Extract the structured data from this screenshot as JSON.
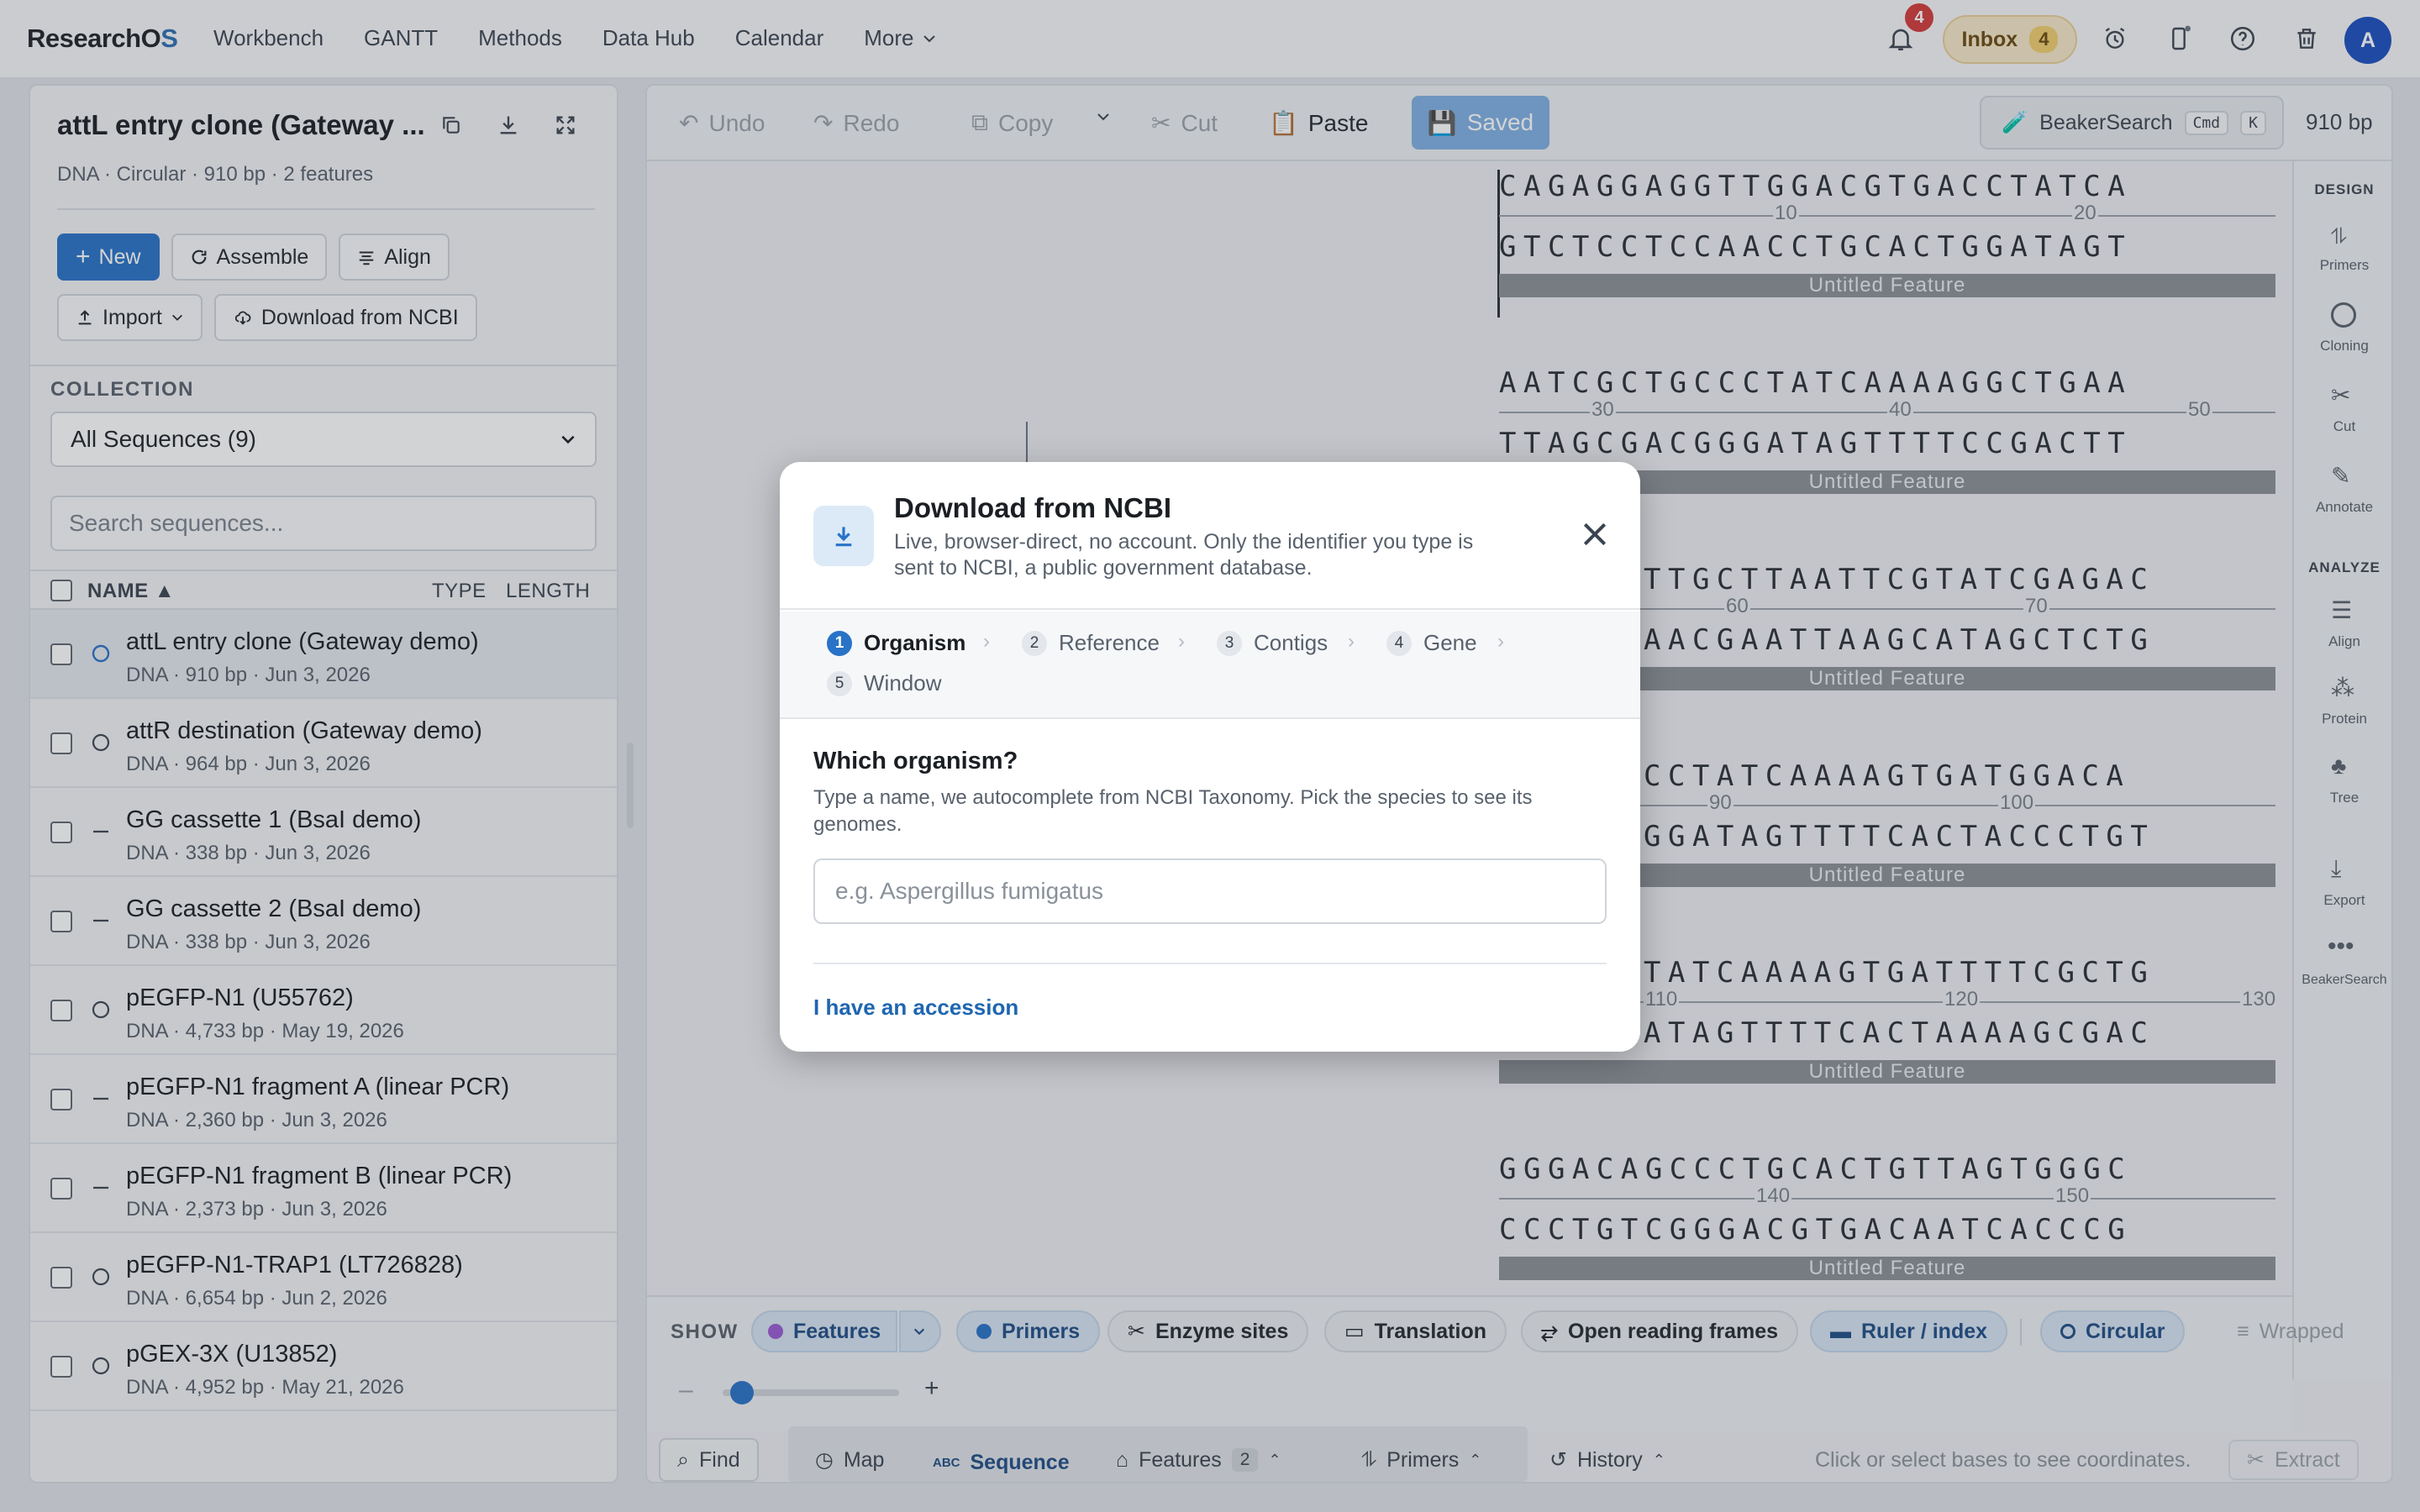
{
  "app": {
    "logo_main": "ResearchO",
    "logo_accent": "S",
    "avatar_initial": "A",
    "notifications_count": "4",
    "inbox_label": "Inbox",
    "inbox_count": "4"
  },
  "nav": [
    "Workbench",
    "GANTT",
    "Methods",
    "Data Hub",
    "Calendar",
    "More"
  ],
  "left": {
    "title": "attL entry clone (Gateway ...",
    "subtitle": "DNA · Circular · 910 bp · 2 features",
    "buttons": {
      "new": "New",
      "assemble": "Assemble",
      "align": "Align",
      "import": "Import",
      "ncbi": "Download from NCBI"
    },
    "collection_label": "COLLECTION",
    "collection_value": "All Sequences (9)",
    "search_placeholder": "Search sequences...",
    "columns": {
      "name": "NAME ▲",
      "type": "TYPE",
      "length": "LENGTH"
    },
    "rows": [
      {
        "name": "attL entry clone (Gateway demo)",
        "meta": "DNA · 910 bp · Jun 3, 2026"
      },
      {
        "name": "attR destination (Gateway demo)",
        "meta": "DNA · 964 bp · Jun 3, 2026"
      },
      {
        "name": "GG cassette 1 (BsaI demo)",
        "meta": "DNA · 338 bp · Jun 3, 2026"
      },
      {
        "name": "GG cassette 2 (BsaI demo)",
        "meta": "DNA · 338 bp · Jun 3, 2026"
      },
      {
        "name": "pEGFP-N1 (U55762)",
        "meta": "DNA · 4,733 bp · May 19, 2026"
      },
      {
        "name": "pEGFP-N1 fragment A (linear PCR)",
        "meta": "DNA · 2,360 bp · Jun 3, 2026"
      },
      {
        "name": "pEGFP-N1 fragment B (linear PCR)",
        "meta": "DNA · 2,373 bp · Jun 3, 2026"
      },
      {
        "name": "pEGFP-N1-TRAP1 (LT726828)",
        "meta": "DNA · 6,654 bp · Jun 2, 2026"
      },
      {
        "name": "pGEX-3X (U13852)",
        "meta": "DNA · 4,952 bp · May 21, 2026"
      }
    ]
  },
  "toolbar": {
    "undo": "Undo",
    "redo": "Redo",
    "copy": "Copy",
    "cut": "Cut",
    "paste": "Paste",
    "saved": "Saved",
    "beaker": "BeakerSearch",
    "kbd_cmd": "Cmd",
    "kbd_k": "K",
    "bp": "910 bp"
  },
  "rail": {
    "design": "DESIGN",
    "primers": "Primers",
    "cloning": "Cloning",
    "cut": "Cut",
    "annotate": "Annotate",
    "analyze": "ANALYZE",
    "align": "Align",
    "protein": "Protein",
    "tree": "Tree",
    "export": "Export",
    "beaker": "BeakerSearch"
  },
  "sequence": {
    "feature_label": "Untitled Feature",
    "blocks": [
      {
        "top": "CAGAGGAGGTTGGACGTGACCTATCA",
        "bottom": "GTCTCCTCCAACCTGCACTGGATAGT",
        "ticks": [
          "10",
          "20"
        ]
      },
      {
        "top": "AATCGCTGCCCTATCAAAAGGCTGAA",
        "bottom": "TTAGCGACGGGATAGTTTTCCGACTT",
        "ticks": [
          "30",
          "40",
          "50"
        ]
      },
      {
        "top": "TTGCTTAATTCGTATCGAGAC",
        "bottom": "AACGAATTAAGCATAGCTCTG",
        "ticks": [
          "60",
          "70"
        ]
      },
      {
        "top": "CCTATCAAAAGTGATGGACA",
        "bottom": "GGATAGTTTTCACTACCCTGT",
        "ticks": [
          "90",
          "100"
        ]
      },
      {
        "top": "TATCAAAAGTGATTTTCGCTG",
        "bottom": "ATAGTTTTCACTAAAAGCGAC",
        "ticks": [
          "110",
          "120",
          "130"
        ]
      },
      {
        "top": "GGGACAGCCCTGCACTGTTAGTGGGC",
        "bottom": "CCCTGTCGGGACGTGACAATCACCCG",
        "ticks": [
          "140",
          "150"
        ]
      }
    ]
  },
  "show": {
    "label": "SHOW",
    "features": "Features",
    "primers": "Primers",
    "enzyme": "Enzyme sites",
    "translation": "Translation",
    "orf": "Open reading frames",
    "ruler": "Ruler / index",
    "circular": "Circular",
    "wrapped": "Wrapped",
    "zoom_level": 0.05
  },
  "bottom": {
    "find": "Find",
    "map": "Map",
    "sequence": "Sequence",
    "features": "Features",
    "features_count": "2",
    "primers": "Primers",
    "history": "History",
    "hint": "Click or select bases to see coordinates.",
    "extract": "Extract"
  },
  "modal": {
    "title": "Download from NCBI",
    "desc": "Live, browser-direct, no account. Only the identifier you type is sent to NCBI, a public government database.",
    "steps": [
      {
        "n": "1",
        "label": "Organism"
      },
      {
        "n": "2",
        "label": "Reference"
      },
      {
        "n": "3",
        "label": "Contigs"
      },
      {
        "n": "4",
        "label": "Gene"
      },
      {
        "n": "5",
        "label": "Window"
      }
    ],
    "question": "Which organism?",
    "question_desc": "Type a name, we autocomplete from NCBI Taxonomy. Pick the species to see its genomes.",
    "input_placeholder": "e.g. Aspergillus fumigatus",
    "link": "I have an accession"
  },
  "colors": {
    "accent": "#2873c7",
    "feature": "#8b9097",
    "saved": "#7fb0e3"
  }
}
